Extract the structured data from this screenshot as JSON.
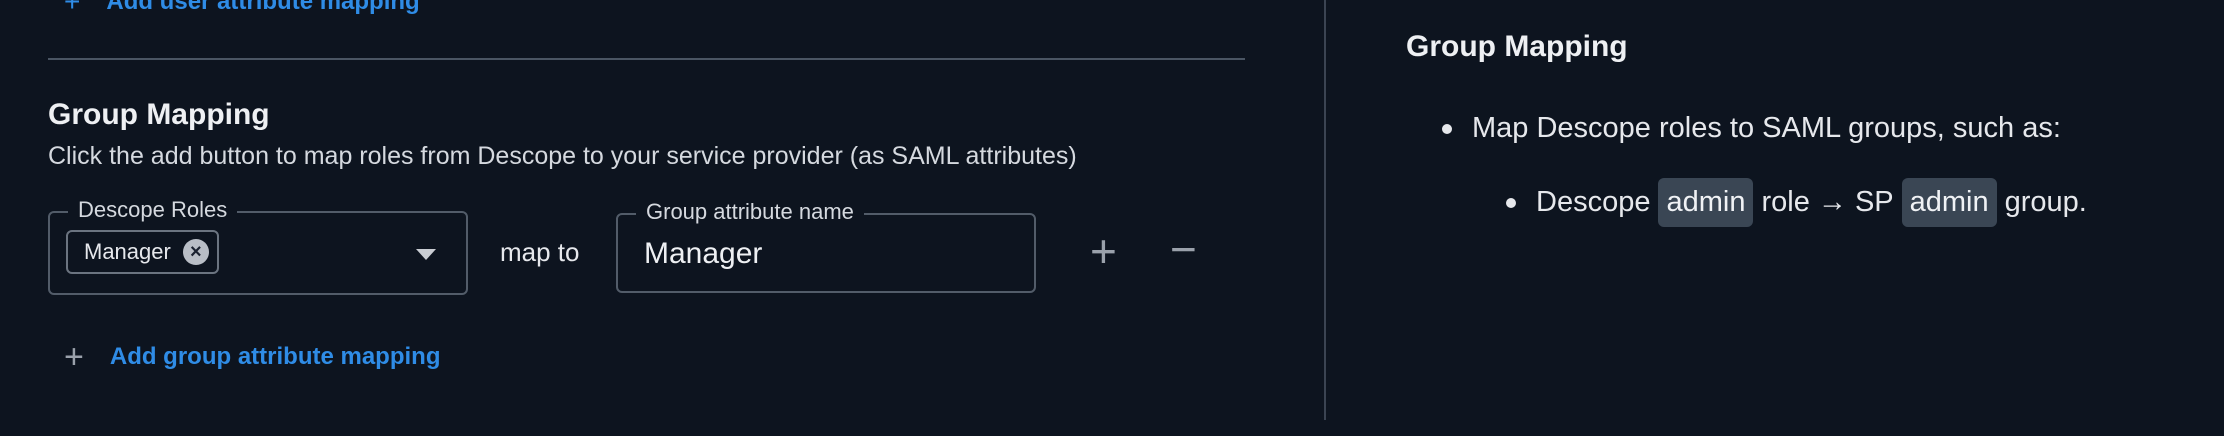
{
  "top_link": {
    "label": "Add user attribute mapping"
  },
  "group_mapping": {
    "title": "Group Mapping",
    "description": "Click the add button to map roles from Descope to your service provider (as SAML attributes)",
    "roles_field": {
      "legend": "Descope Roles",
      "selected_chip": "Manager"
    },
    "map_to_label": "map to",
    "attribute_field": {
      "legend": "Group attribute name",
      "value": "Manager"
    },
    "add_link": "Add group attribute mapping"
  },
  "help": {
    "title": "Group Mapping",
    "bullet_1": "Map Descope roles to SAML groups, such as:",
    "bullet_2": {
      "part_1": "Descope",
      "code_1": "admin",
      "part_2": "role → SP",
      "code_2": "admin",
      "part_3": "group."
    }
  },
  "icons": {
    "add": "plus-icon",
    "remove": "minus-icon",
    "chip_remove": "close-circle-icon",
    "dropdown": "caret-down-icon"
  },
  "colors": {
    "background": "#0d141f",
    "link": "#2f8ce6",
    "chip": "#3a4654"
  }
}
